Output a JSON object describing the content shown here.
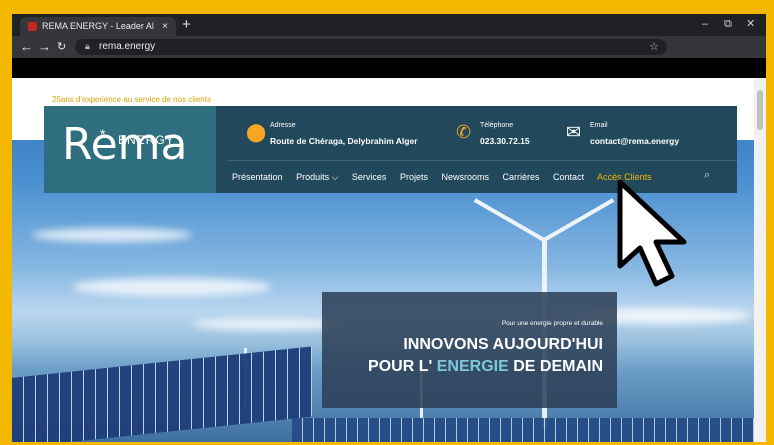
{
  "browser": {
    "tab_title": "REMA ENERGY - Leader Algérien",
    "url": "rema.energy",
    "new_tab": "+",
    "tab_close": "×",
    "win_min": "–",
    "win_max": "⧉",
    "win_close": "✕"
  },
  "site": {
    "tagline": "25ans d'experience au service de nos clients",
    "logo_main": "Rema",
    "logo_energy": "ENERGY",
    "address_label": "Adresse",
    "address_value": "Route de Chéraga, Delybrahim Alger",
    "phone_label": "Téléphone",
    "phone_value": "023.30.72.15",
    "email_label": "Email",
    "email_value": "contact@rema.energy",
    "menu": [
      "Présentation",
      "Produits ⌵",
      "Services",
      "Projets",
      "Newsrooms",
      "Carrières",
      "Contact",
      "Accès Clients"
    ],
    "hero_small": "Pour une energie propre et durable",
    "hero_line1": "INNOVONS AUJOURD'HUI",
    "hero_line2_a": "POUR L' ",
    "hero_line2_accent": "ENERGIE",
    "hero_line2_b": " DE DEMAIN"
  },
  "colors": {
    "frame": "#f5b800",
    "header_bg": "#22495b",
    "logo_bg": "#2f6e7e",
    "accent": "#f5a623",
    "highlight_menu": "#f5b800"
  }
}
